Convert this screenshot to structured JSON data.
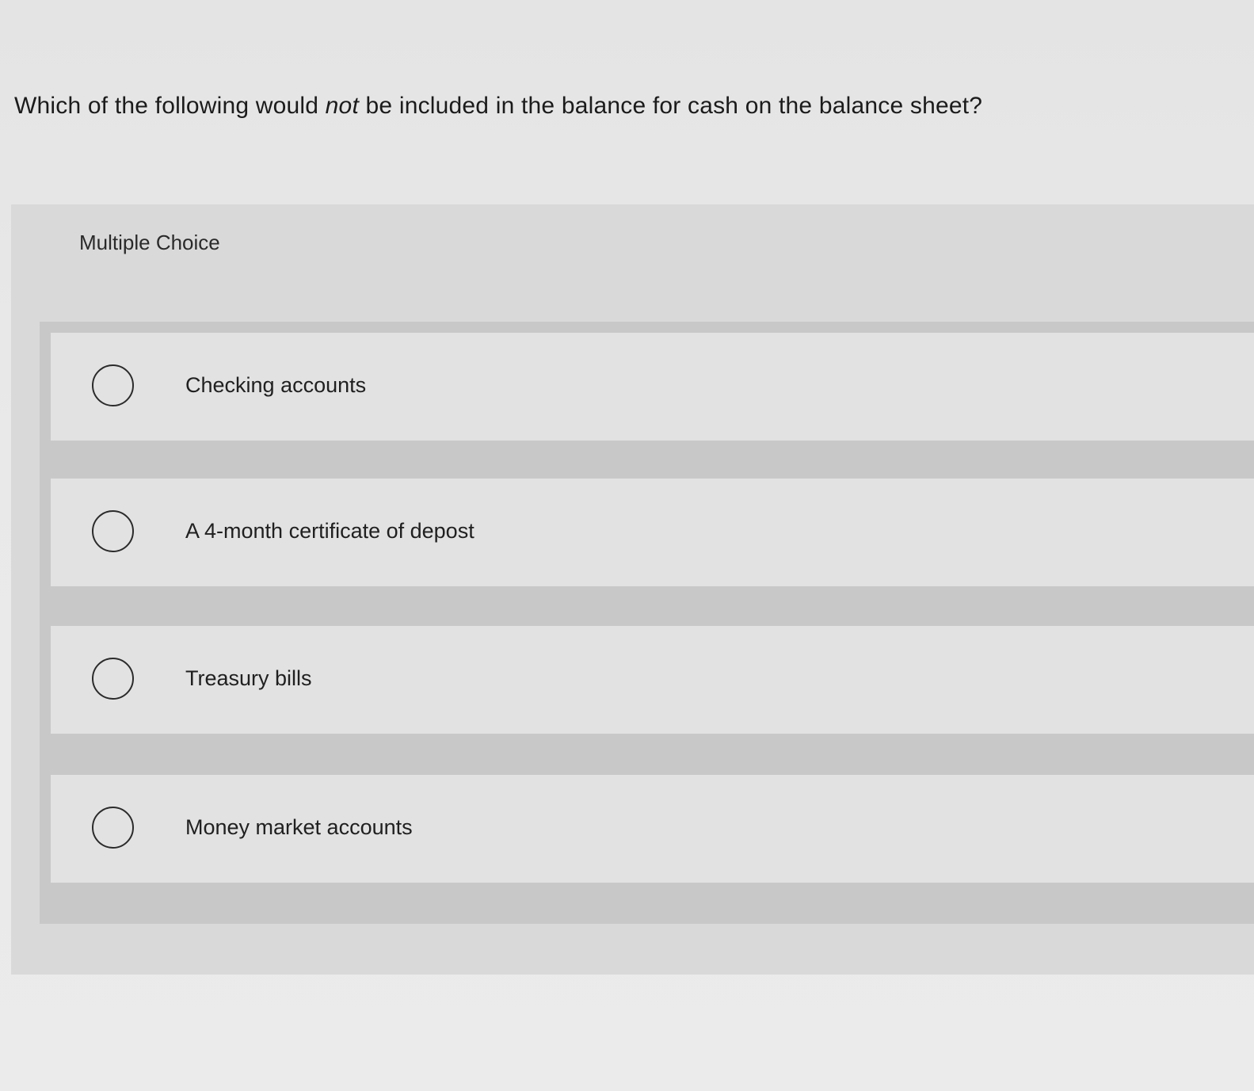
{
  "question": {
    "text_before": "Which of the following would ",
    "text_emphasis": "not",
    "text_after": " be included in the balance for cash on the balance sheet?"
  },
  "panel": {
    "title": "Multiple Choice"
  },
  "choices": [
    {
      "label": "Checking accounts",
      "selected": false
    },
    {
      "label": "A 4-month certificate of depost",
      "selected": false
    },
    {
      "label": "Treasury bills",
      "selected": false
    },
    {
      "label": "Money market accounts",
      "selected": false
    }
  ]
}
